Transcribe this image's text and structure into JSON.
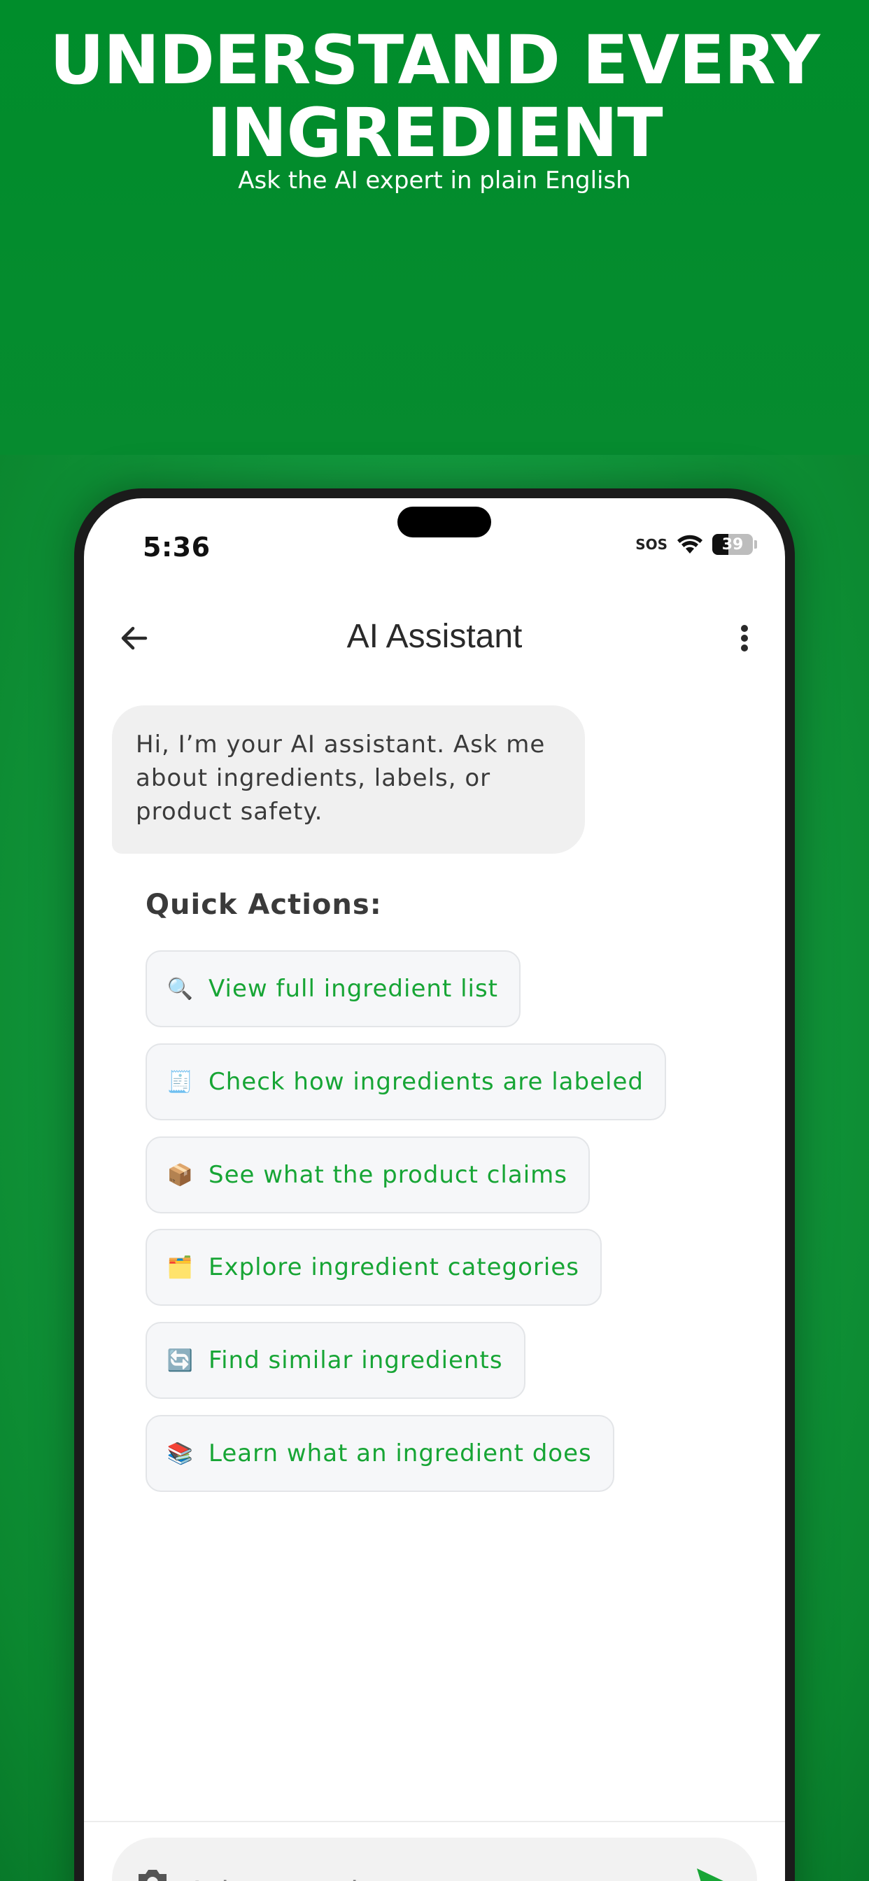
{
  "promo": {
    "headline_line1": "UNDERSTAND EVERY",
    "headline_line2": "INGREDIENT",
    "subheadline": "Ask the AI expert in plain English"
  },
  "status_bar": {
    "time": "5:36",
    "sos": "SOS",
    "battery_level": "39"
  },
  "app_bar": {
    "title": "AI Assistant",
    "back_icon": "arrow-left-icon",
    "menu_icon": "more-vertical-icon"
  },
  "chat": {
    "assistant_message": "Hi, I’m your AI assistant. Ask me about ingredients, labels, or product safety."
  },
  "quick_actions": {
    "title": "Quick Actions:",
    "items": [
      {
        "icon": "🔍",
        "icon_name": "magnifier-icon",
        "label": "View full ingredient list"
      },
      {
        "icon": "🧾",
        "icon_name": "receipt-icon",
        "label": "Check how ingredients are labeled"
      },
      {
        "icon": "📦",
        "icon_name": "package-icon",
        "label": "See what the product claims"
      },
      {
        "icon": "🗂️",
        "icon_name": "card-index-dividers-icon",
        "label": "Explore ingredient categories"
      },
      {
        "icon": "🔄",
        "icon_name": "refresh-icon",
        "label": "Find similar ingredients"
      },
      {
        "icon": "📚",
        "icon_name": "books-icon",
        "label": "Learn what an ingredient does"
      }
    ]
  },
  "input": {
    "placeholder": "Ask a question...",
    "camera_icon": "camera-icon",
    "send_icon": "send-icon"
  },
  "colors": {
    "brand_green": "#008d2b",
    "chip_text": "#17a535"
  }
}
